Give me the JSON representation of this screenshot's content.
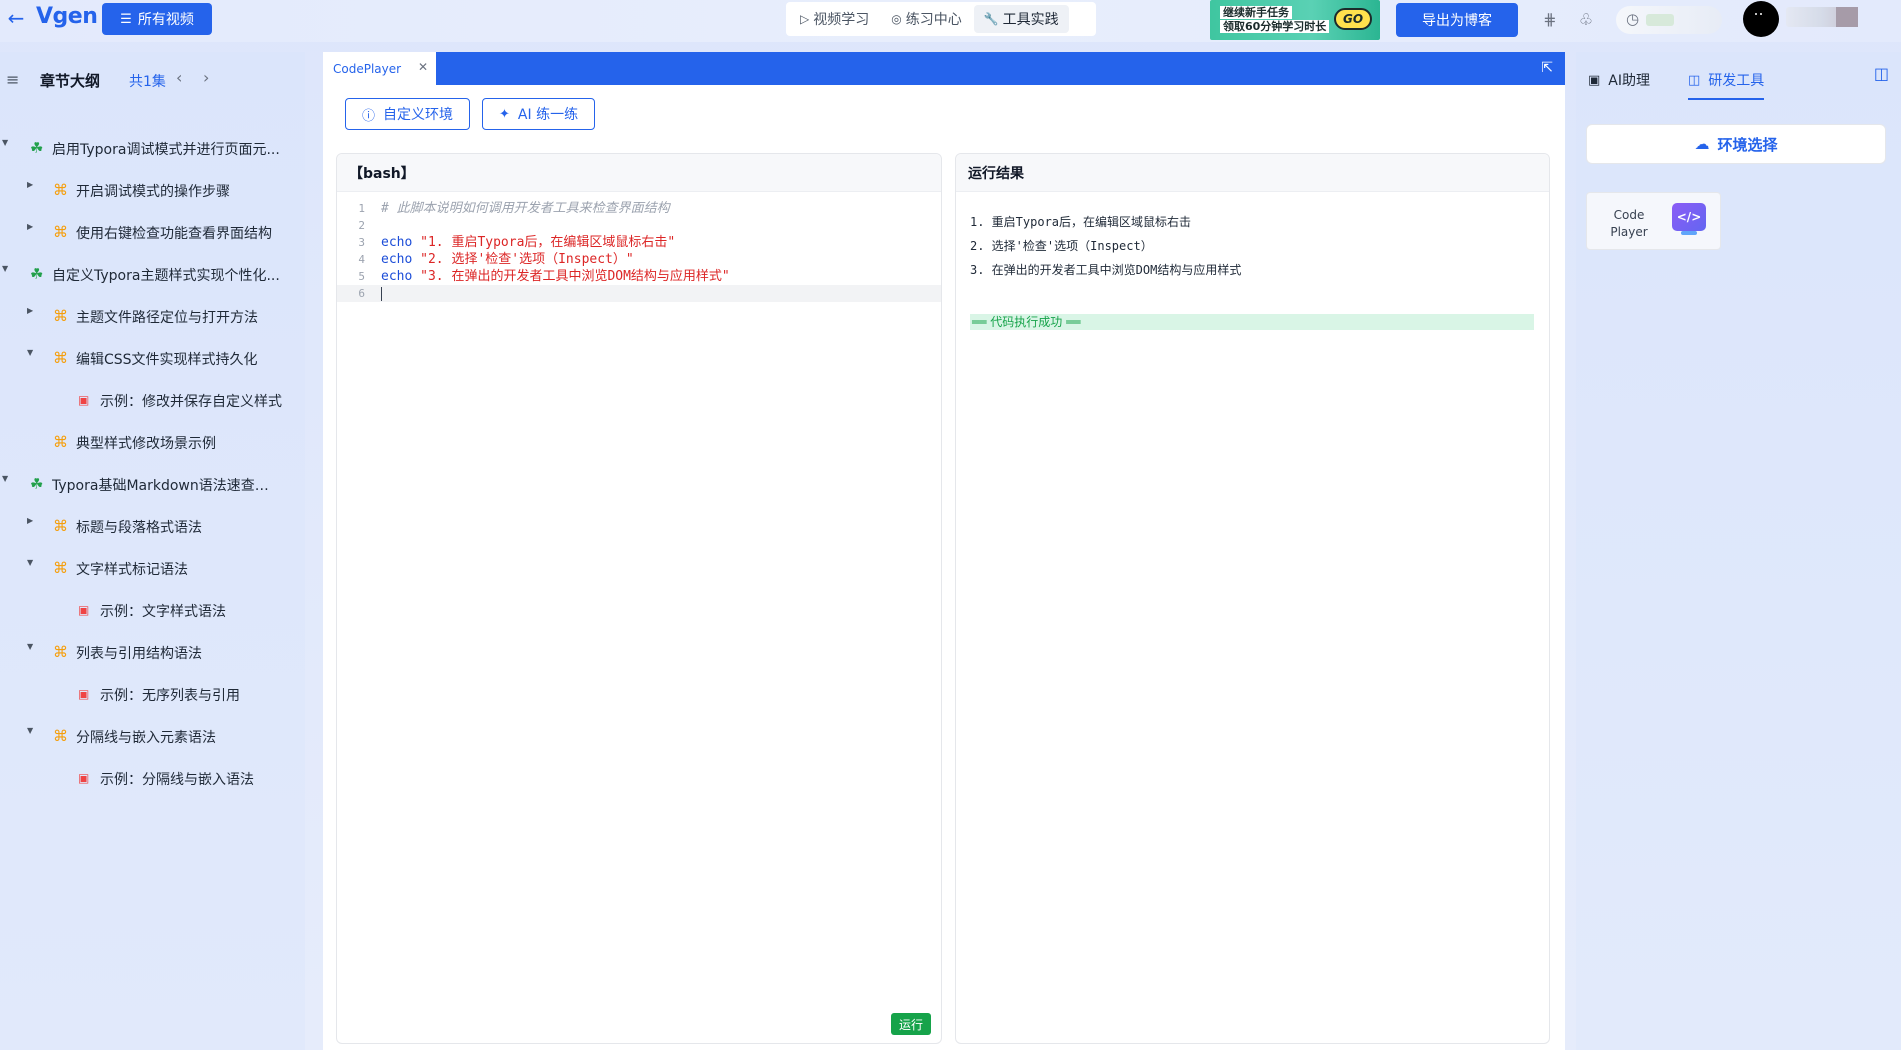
{
  "header": {
    "back_icon": "arrow-left-icon",
    "logo": "Vgen",
    "all_videos_label": "所有视频",
    "mode_tabs": [
      {
        "label": "视频学习",
        "icon": "play-icon",
        "active": false
      },
      {
        "label": "练习中心",
        "icon": "target-icon",
        "active": false
      },
      {
        "label": "工具实践",
        "icon": "wrench-icon",
        "active": true
      }
    ],
    "promo": {
      "line1": "继续新手任务",
      "line2": "领取60分钟学习时长",
      "go": "GO"
    },
    "export_label": "导出为博客"
  },
  "sidebar": {
    "title": "章节大纲",
    "count": "共1集",
    "items": [
      {
        "level": 1,
        "label": "启用Typora调试模式并进行页面元...",
        "expanded": true
      },
      {
        "level": 2,
        "label": "开启调试模式的操作步骤",
        "expanded": false
      },
      {
        "level": 2,
        "label": "使用右键检查功能查看界面结构",
        "expanded": false
      },
      {
        "level": 1,
        "label": "自定义Typora主题样式实现个性化...",
        "expanded": true
      },
      {
        "level": 2,
        "label": "主题文件路径定位与打开方法",
        "expanded": false
      },
      {
        "level": 2,
        "label": "编辑CSS文件实现样式持久化",
        "expanded": true
      },
      {
        "level": 3,
        "label": "示例：修改并保存自定义样式"
      },
      {
        "level": 2,
        "label": "典型样式修改场景示例",
        "expanded": null
      },
      {
        "level": 1,
        "label": "Typora基础Markdown语法速查手册",
        "expanded": true
      },
      {
        "level": 2,
        "label": "标题与段落格式语法",
        "expanded": false
      },
      {
        "level": 2,
        "label": "文字样式标记语法",
        "expanded": true
      },
      {
        "level": 3,
        "label": "示例：文字样式语法"
      },
      {
        "level": 2,
        "label": "列表与引用结构语法",
        "expanded": true
      },
      {
        "level": 3,
        "label": "示例：无序列表与引用"
      },
      {
        "level": 2,
        "label": "分隔线与嵌入元素语法",
        "expanded": true
      },
      {
        "level": 3,
        "label": "示例：分隔线与嵌入语法"
      }
    ]
  },
  "center": {
    "tab_label": "CodePlayer",
    "custom_env_label": "自定义环境",
    "ai_practice_label": "AI 练一练",
    "code_panel_title": "【bash】",
    "code_lines": [
      {
        "n": "1",
        "comment": "# 此脚本说明如何调用开发者工具来检查界面结构"
      },
      {
        "n": "2"
      },
      {
        "n": "3",
        "kw": "echo",
        "str": "\"1. 重启Typora后，在编辑区域鼠标右击\""
      },
      {
        "n": "4",
        "kw": "echo",
        "str": "\"2. 选择'检查'选项（Inspect）\""
      },
      {
        "n": "5",
        "kw": "echo",
        "str": "\"3. 在弹出的开发者工具中浏览DOM结构与应用样式\""
      },
      {
        "n": "6",
        "active": true
      }
    ],
    "run_label": "运行",
    "result_title": "运行结果",
    "result_lines": [
      "1. 重启Typora后，在编辑区域鼠标右击",
      "2. 选择'检查'选项（Inspect）",
      "3. 在弹出的开发者工具中浏览DOM结构与应用样式"
    ],
    "success_text": "══ 代码执行成功 ══"
  },
  "right_panel": {
    "tab_ai": "AI助理",
    "tab_dev": "研发工具",
    "env_select_label": "环境选择",
    "tool_card": {
      "name_line1": "Code",
      "name_line2": "Player",
      "icon_text": "</>"
    }
  }
}
